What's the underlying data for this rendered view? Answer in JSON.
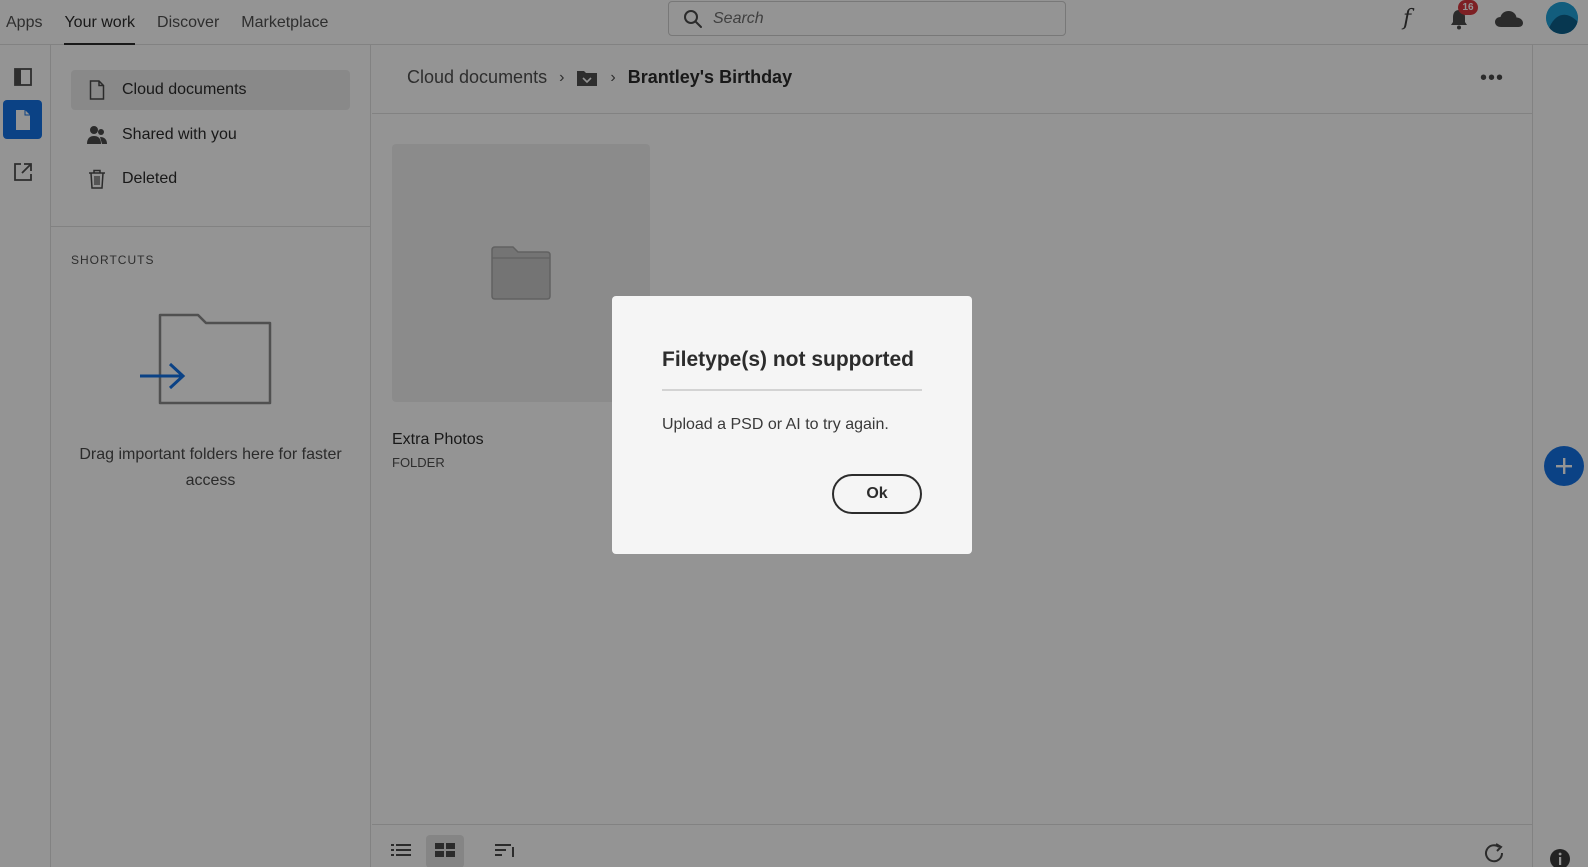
{
  "topnav": {
    "items": [
      {
        "label": "Apps"
      },
      {
        "label": "Your work",
        "active": true
      },
      {
        "label": "Discover"
      },
      {
        "label": "Marketplace"
      }
    ]
  },
  "search": {
    "placeholder": "Search"
  },
  "header": {
    "fonts_icon": "f",
    "notifications_count": "16",
    "icons": [
      "fonts-icon",
      "bell-icon",
      "cloud-icon",
      "avatar"
    ]
  },
  "rail": {
    "icons": [
      "layers-icon",
      "document-icon",
      "external-link-icon"
    ],
    "active": "document-icon",
    "accent": "#1473e6"
  },
  "sidebar": {
    "items": [
      {
        "label": "Cloud documents",
        "icon": "document-icon",
        "active": true
      },
      {
        "label": "Shared with you",
        "icon": "shared-users-icon"
      },
      {
        "label": "Deleted",
        "icon": "trash-icon"
      }
    ],
    "shortcuts_heading": "SHORTCUTS",
    "shortcuts_hint": "Drag important folders here for faster access"
  },
  "main": {
    "breadcrumb": {
      "root": "Cloud documents",
      "current": "Brantley's Birthday"
    },
    "more_label": "•••",
    "items": [
      {
        "name": "Extra Photos",
        "type": "FOLDER",
        "icon": "folder-icon"
      }
    ]
  },
  "dialog": {
    "title": "Filetype(s) not supported",
    "message": "Upload a PSD or AI to try again.",
    "ok_label": "Ok"
  },
  "colors": {
    "accent": "#1473e6",
    "badge": "#d7373f",
    "overlay": "rgba(0,0,0,0.42)"
  }
}
